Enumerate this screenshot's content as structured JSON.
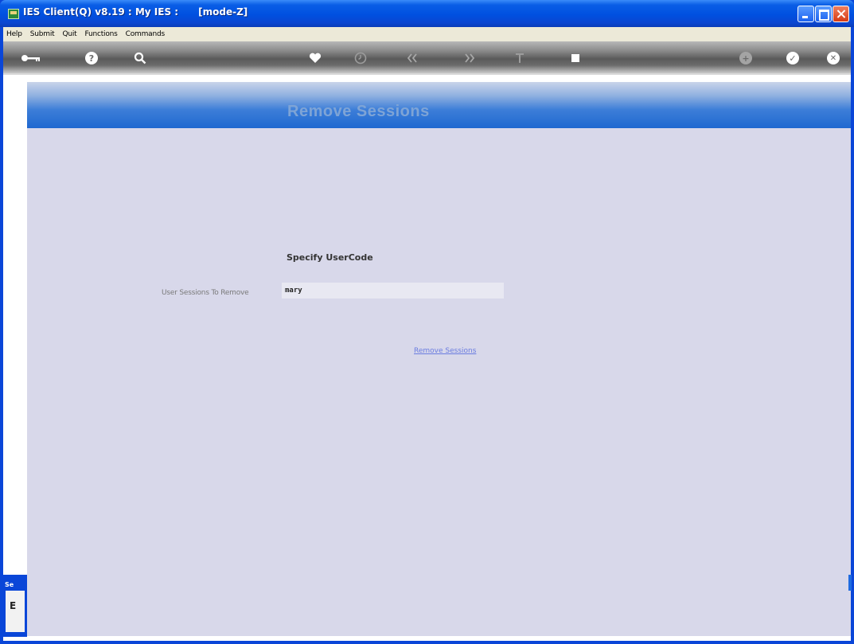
{
  "window": {
    "title": "IES Client(Q) v8.19 : My IES :      [mode-Z]"
  },
  "menubar": {
    "items": [
      "Help",
      "Submit",
      "Quit",
      "Functions",
      "Commands"
    ]
  },
  "toolbar": {
    "icons": [
      "key-icon",
      "help-icon",
      "search-icon",
      "heart-icon",
      "clock-icon",
      "previous-icon",
      "next-icon",
      "text-icon",
      "stop-icon",
      "add-icon",
      "accept-icon",
      "cancel-icon"
    ]
  },
  "page": {
    "title": "Remove Sessions",
    "section_heading": "Specify UserCode",
    "field_label": "User Sessions To Remove",
    "field_value": "mary",
    "action_link": "Remove Sessions"
  },
  "mini_panel": {
    "label": "Se",
    "glyph": "E"
  },
  "colors": {
    "title_bar": "#0a50e0",
    "content_background": "#d8d8ea",
    "header_gradient_bottom": "#1f68d0",
    "link": "#6a7ce0"
  }
}
